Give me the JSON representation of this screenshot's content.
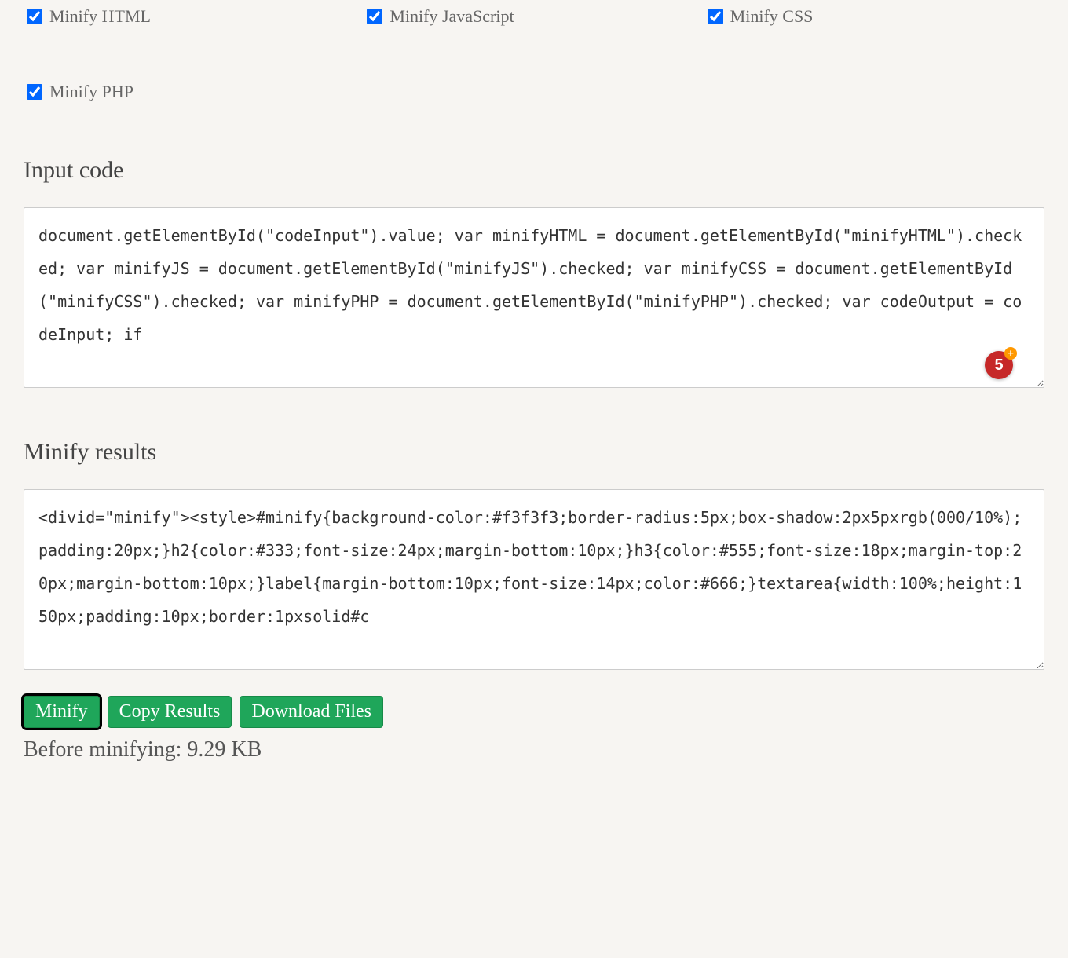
{
  "options": {
    "minifyHTML": {
      "label": "Minify HTML",
      "checked": true
    },
    "minifyJS": {
      "label": "Minify JavaScript",
      "checked": true
    },
    "minifyCSS": {
      "label": "Minify CSS",
      "checked": true
    },
    "minifyPHP": {
      "label": "Minify PHP",
      "checked": true
    }
  },
  "sections": {
    "input_heading": "Input code",
    "output_heading": "Minify results"
  },
  "input_code": "document.getElementById(\"codeInput\").value; var minifyHTML = document.getElementById(\"minifyHTML\").checked; var minifyJS = document.getElementById(\"minifyJS\").checked; var minifyCSS = document.getElementById(\"minifyCSS\").checked; var minifyPHP = document.getElementById(\"minifyPHP\").checked; var codeOutput = codeInput; if",
  "output_code": "<divid=\"minify\"><style>#minify{background-color:#f3f3f3;border-radius:5px;box-shadow:2px5pxrgb(000/10%);padding:20px;}h2{color:#333;font-size:24px;margin-bottom:10px;}h3{color:#555;font-size:18px;margin-top:20px;margin-bottom:10px;}label{margin-bottom:10px;font-size:14px;color:#666;}textarea{width:100%;height:150px;padding:10px;border:1pxsolid#c",
  "badge": {
    "value": "5"
  },
  "buttons": {
    "minify": "Minify",
    "copy": "Copy Results",
    "download": "Download Files"
  },
  "status": {
    "before_label": "Before minifying:",
    "before_size": "9.29 KB"
  }
}
